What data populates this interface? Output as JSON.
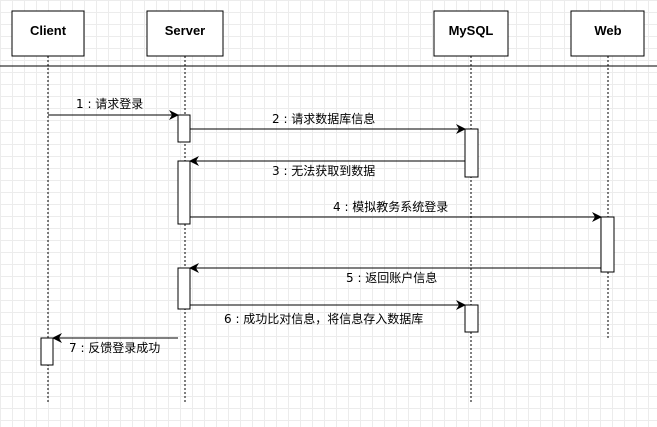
{
  "actors": [
    {
      "id": "client",
      "label": "Client"
    },
    {
      "id": "server",
      "label": "Server"
    },
    {
      "id": "mysql",
      "label": "MySQL"
    },
    {
      "id": "web",
      "label": "Web"
    }
  ],
  "messages": [
    {
      "label": "1 : 请求登录"
    },
    {
      "label": "2 : 请求数据库信息"
    },
    {
      "label": "3 : 无法获取到数据"
    },
    {
      "label": "4 : 模拟教务系统登录"
    },
    {
      "label": "5 : 返回账户信息"
    },
    {
      "label": "6 : 成功比对信息，将信息存入数据库"
    },
    {
      "label": "7 : 反馈登录成功"
    }
  ]
}
